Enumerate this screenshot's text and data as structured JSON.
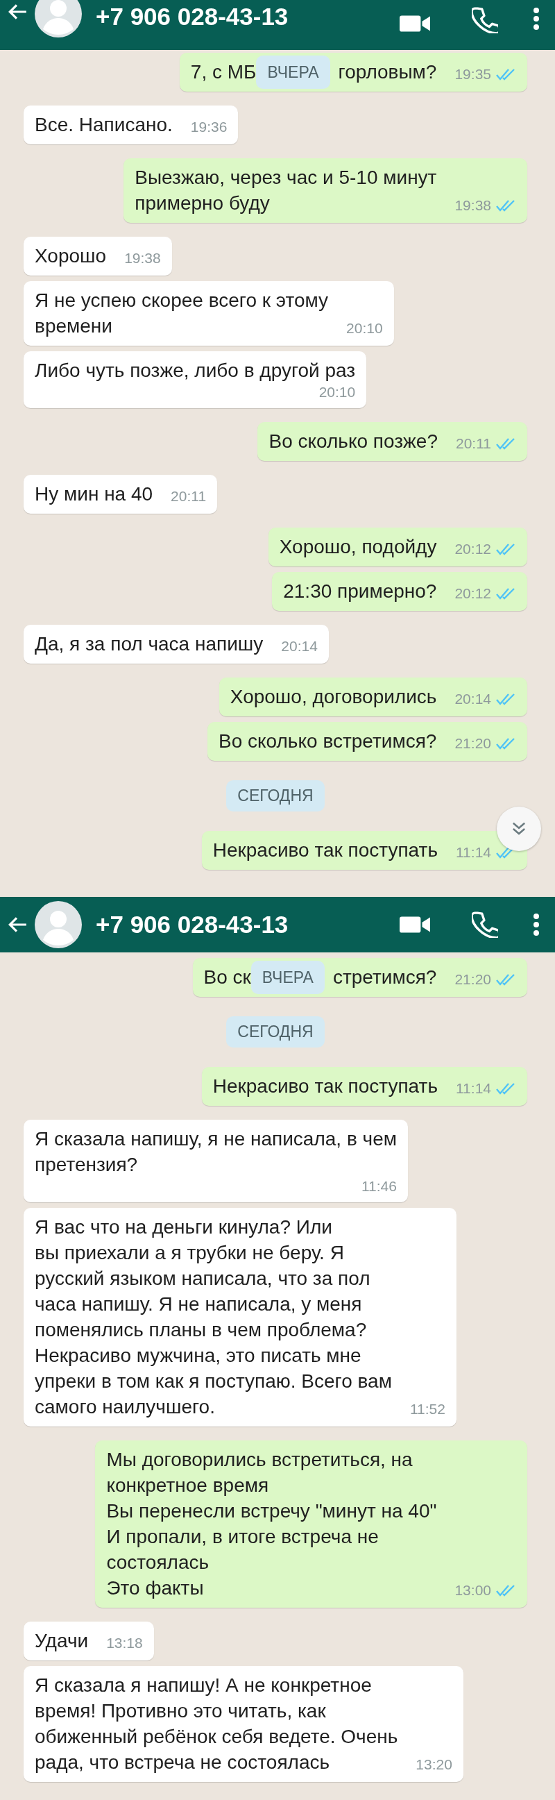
{
  "screens": [
    {
      "header": {
        "title": "+7 906 028-43-13"
      },
      "scroll_down_button": true,
      "messages": [
        {
          "kind": "out",
          "text_before": "7, с МБ",
          "date_overlay": "ВЧЕРА",
          "text_after": "горловым?",
          "time": "19:35",
          "read": true
        },
        {
          "kind": "in",
          "text": "Все. Написано.",
          "time": "19:36"
        },
        {
          "kind": "out",
          "text": "Выезжаю, через час и 5-10 минут\nпримерно буду",
          "time": "19:38",
          "read": true
        },
        {
          "kind": "in",
          "text": "Хорошо",
          "time": "19:38"
        },
        {
          "kind": "in",
          "text": "Я не успею скорее всего к этому\nвремени",
          "time": "20:10"
        },
        {
          "kind": "in",
          "text": "Либо чуть позже, либо в другой раз",
          "time": "20:10",
          "time_below": true
        },
        {
          "kind": "out",
          "text": "Во сколько позже?",
          "time": "20:11",
          "read": true
        },
        {
          "kind": "in",
          "text": "Ну мин на 40",
          "time": "20:11"
        },
        {
          "kind": "out",
          "text": "Хорошо, подойду",
          "time": "20:12",
          "read": true
        },
        {
          "kind": "out",
          "text": "21:30 примерно?",
          "time": "20:12",
          "read": true
        },
        {
          "kind": "in",
          "text": "Да, я за пол часа напишу",
          "time": "20:14"
        },
        {
          "kind": "out",
          "text": "Хорошо, договорились",
          "time": "20:14",
          "read": true
        },
        {
          "kind": "out",
          "text": "Во сколько встретимся?",
          "time": "21:20",
          "read": true
        },
        {
          "kind": "date",
          "text": "СЕГОДНЯ"
        },
        {
          "kind": "out",
          "text": "Некрасиво так поступать",
          "time": "11:14",
          "read": true
        }
      ]
    },
    {
      "header": {
        "title": "+7 906 028-43-13"
      },
      "messages": [
        {
          "kind": "out",
          "text_before": "Во ск",
          "date_overlay": "ВЧЕРА",
          "text_after": "стретимся?",
          "time": "21:20",
          "read": true
        },
        {
          "kind": "date",
          "text": "СЕГОДНЯ"
        },
        {
          "kind": "out",
          "text": "Некрасиво так поступать",
          "time": "11:14",
          "read": true
        },
        {
          "kind": "in",
          "text": "Я сказала напишу, я не написала, в чем\nпретензия?",
          "time": "11:46",
          "time_below": true
        },
        {
          "kind": "in",
          "text": "Я вас что на деньги кинула? Или\nвы приехали а я трубки не беру. Я\nрусский языком написала, что за пол\nчаса напишу. Я не написала, у меня\nпоменялись планы в чем проблема?\nНекрасиво мужчина, это писать мне\nупреки в том как я поступаю. Всего вам\nсамого наилучшего.",
          "time": "11:52"
        },
        {
          "kind": "out",
          "text": "Мы договорились встретиться, на\nконкретное время\nВы перенесли встречу \"минут на 40\"\nИ пропали, в итоге встреча не\nсостоялась\nЭто факты",
          "time": "13:00",
          "read": true
        },
        {
          "kind": "in",
          "text": "Удачи",
          "time": "13:18"
        },
        {
          "kind": "in",
          "text": "Я сказала я напишу! А не конкретное\nвремя! Противно это читать, как\nобиженный ребёнок себя ведете. Очень\nрада, что встреча не состоялась",
          "time": "13:20"
        }
      ]
    }
  ]
}
